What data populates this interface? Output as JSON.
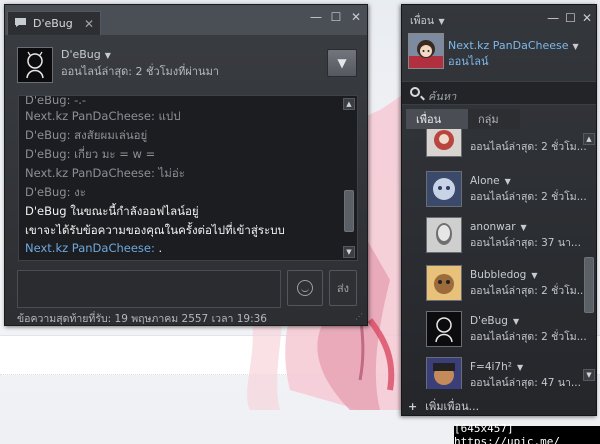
{
  "chat_window": {
    "tab_title": "D'eBug",
    "contact_name": "D'eBug",
    "contact_status": "ออนไลน์ล่าสุด: 2 ชั่วโมงที่ผ่านมา",
    "messages": [
      {
        "text": "D'eBug: -.-",
        "style": "dim"
      },
      {
        "text": "Next.kz PanDaCheese: แปป",
        "style": "dim"
      },
      {
        "text": "D'eBug: สงสัยผมเล่นอยู่",
        "style": "dim"
      },
      {
        "text": "D'eBug: เกี่ยว มะ = w =",
        "style": "dim"
      },
      {
        "text": "Next.kz PanDaCheese: ไม่อ่ะ",
        "style": "dim"
      },
      {
        "text": "D'eBug: งะ",
        "style": "dim"
      },
      {
        "text": "D'eBug ในขณะนี้กำลังออฟไลน์อยู่",
        "style": "white"
      },
      {
        "text": "เขาจะได้รับข้อความของคุณในครั้งต่อไปที่เข้าสู่ระบบ",
        "style": "white"
      }
    ],
    "typing_sender": "Next.kz PanDaCheese:",
    "typing_text": ".",
    "input_value": "",
    "send_label": "ส่ง",
    "last_message_info": "ข้อความสุดท้ายที่รับ: 19 พฤษภาคม 2557 เวลา 19:36"
  },
  "friends_panel": {
    "title": "เพื่อน",
    "my_name": "Next.kz PanDaCheese",
    "my_status": "ออนไลน์",
    "search_placeholder": "ค้นหา",
    "tabs": [
      "เพื่อน",
      "กลุ่ม"
    ],
    "friends": [
      {
        "name": "",
        "status": "ออนไลน์ล่าสุด: 2 ชั่วโม..."
      },
      {
        "name": "Alone",
        "status": "ออนไลน์ล่าสุด: 2 ชั่วโม..."
      },
      {
        "name": "anonwar",
        "status": "ออนไลน์ล่าสุด: 37 นา..."
      },
      {
        "name": "Bubbledog",
        "status": "ออนไลน์ล่าสุด: 2 ชั่วโม..."
      },
      {
        "name": "D'eBug",
        "status": "ออนไลน์ล่าสุด: 2 ชั่วโม..."
      },
      {
        "name": "F=4i7h²",
        "status": "ออนไลน์ล่าสุด: 47 นา..."
      }
    ],
    "add_friend_label": "เพิ่มเพื่อน..."
  },
  "watermark": "[645x457] https://upic.me/",
  "colors": {
    "window_bg": "#2c2e32",
    "link_blue": "#7fb9ea",
    "message_dim": "#8b9096",
    "message_white": "#f2f2f2"
  },
  "icons": [
    "chat-bubble-icon",
    "close-icon",
    "minimize-icon",
    "maximize-icon",
    "chevron-down-icon",
    "smiley-icon",
    "search-icon",
    "plus-icon"
  ]
}
